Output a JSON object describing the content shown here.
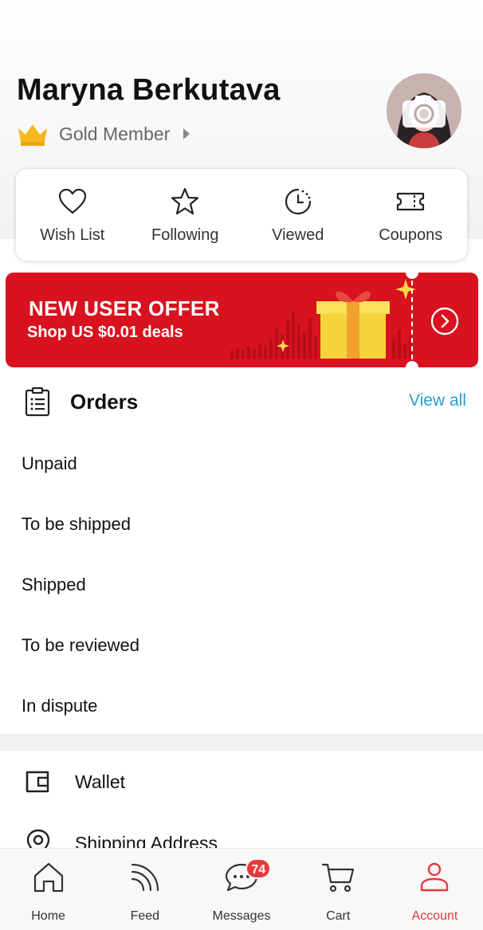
{
  "profile": {
    "name": "Maryna Berkutava",
    "membership": "Gold Member"
  },
  "quick_links": [
    {
      "label": "Wish List",
      "icon": "heart-icon"
    },
    {
      "label": "Following",
      "icon": "star-icon"
    },
    {
      "label": "Viewed",
      "icon": "history-clock-icon"
    },
    {
      "label": "Coupons",
      "icon": "ticket-icon"
    }
  ],
  "promo_banner": {
    "title": "NEW USER OFFER",
    "subtitle": "Shop US $0.01 deals",
    "color": "#d8121f"
  },
  "orders": {
    "title": "Orders",
    "view_all": "View all",
    "items": [
      "Unpaid",
      "To be shipped",
      "Shipped",
      "To be reviewed",
      "In dispute"
    ]
  },
  "menu": {
    "wallet": "Wallet",
    "shipping_address": "Shipping Address"
  },
  "bottom_nav": {
    "home": "Home",
    "feed": "Feed",
    "messages": "Messages",
    "messages_badge": "74",
    "cart": "Cart",
    "account": "Account",
    "active": "Account",
    "accent_color": "#e8383a"
  }
}
